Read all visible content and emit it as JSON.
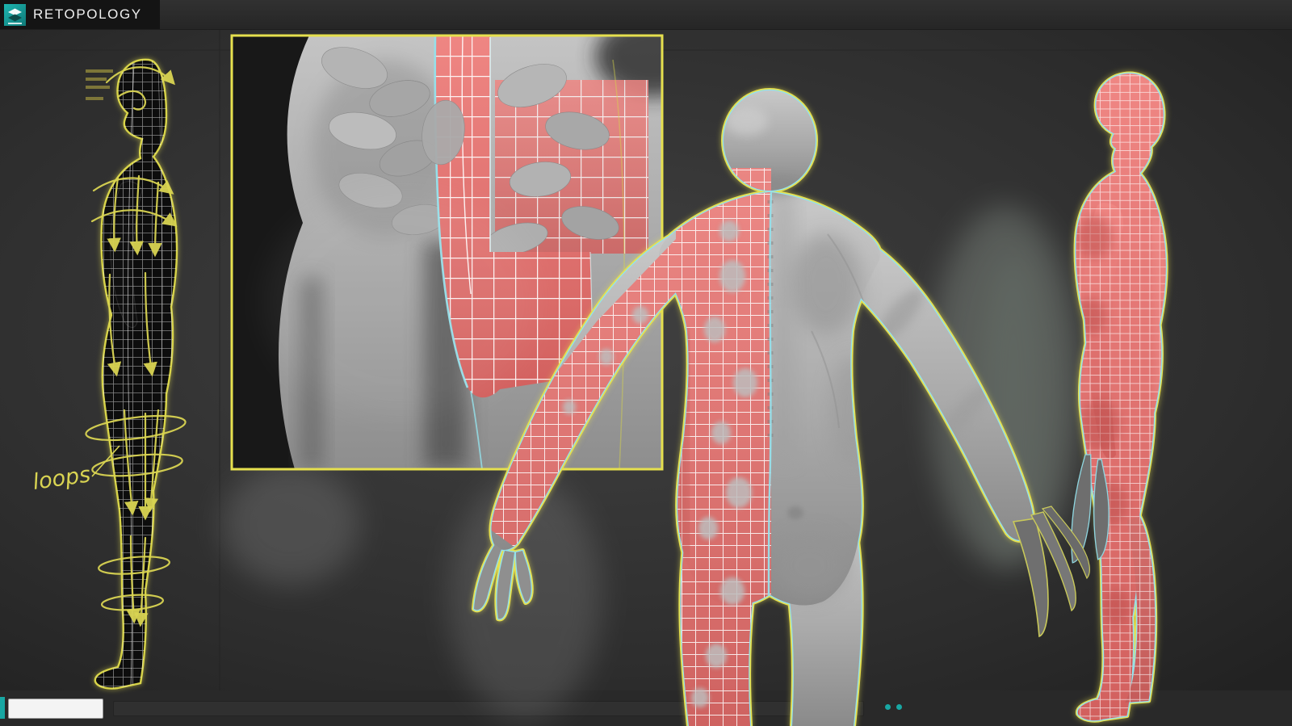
{
  "header": {
    "title": "RETOPOLOGY"
  },
  "viewport": {
    "loops_label": "loops"
  },
  "toolbar": {
    "icons": [
      "⊞",
      "⟲",
      "⟳",
      "⊕",
      "∠",
      "◧",
      "▦",
      "◈",
      "◻",
      "⌖",
      "≡",
      "◇",
      "⊟"
    ]
  },
  "command_panel": {
    "tabs": [
      "+",
      "≈",
      "⚙",
      "◔",
      "▢",
      "≣"
    ]
  },
  "colors": {
    "accent-teal": "#18a7a3",
    "retopo-red": "#e2706d",
    "outline-yellow": "#e6e04e",
    "outline-cyan": "#93e2ec",
    "wire-white": "#f2f2f2",
    "bg-dark": "#2c2c2c"
  }
}
